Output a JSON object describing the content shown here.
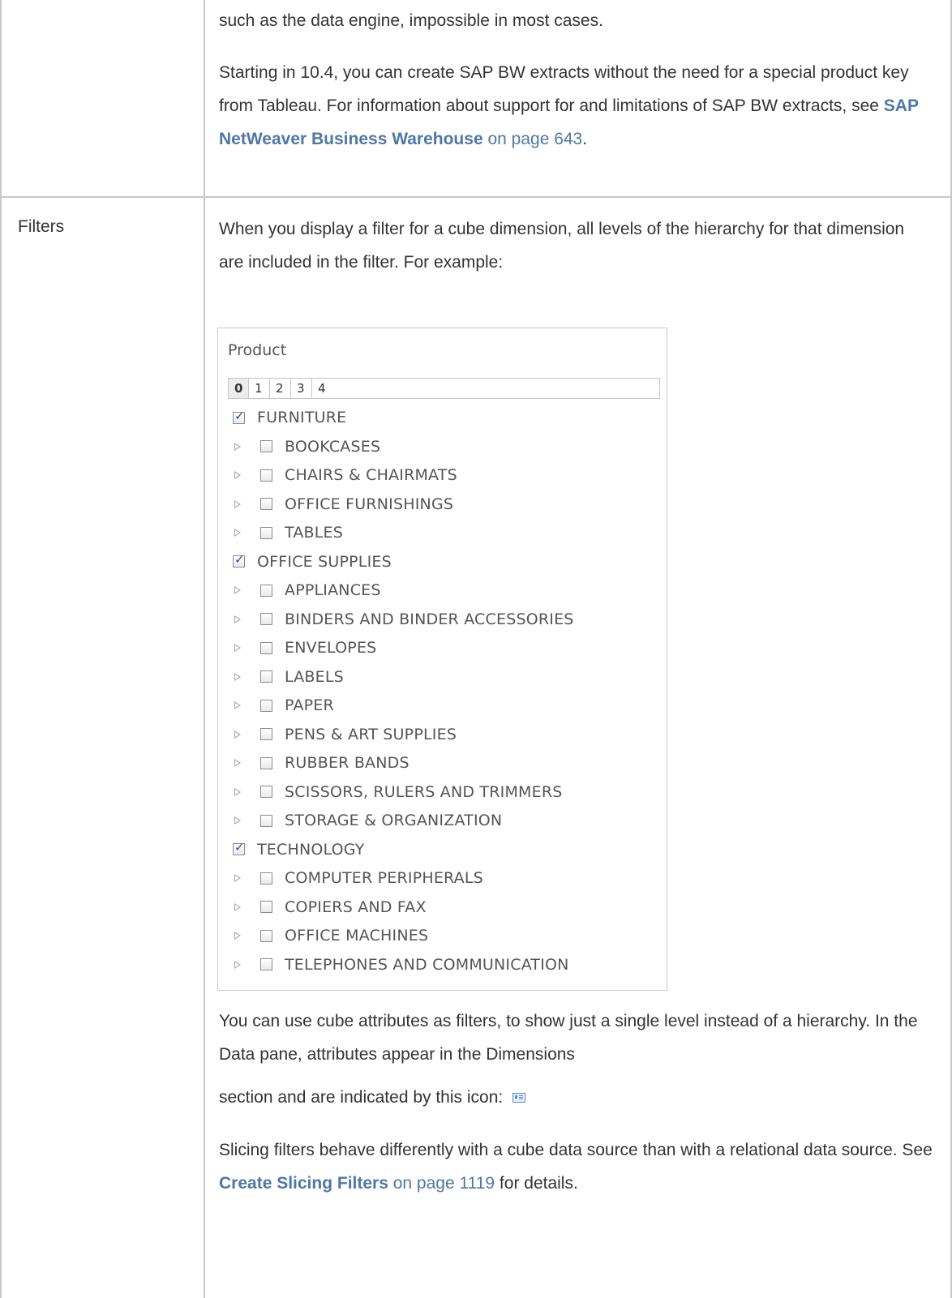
{
  "row1": {
    "continued_text": "such as the data engine, impossible in most cases.",
    "paragraph_start": "Starting in 10.4, you can create SAP BW extracts without the need for a special product key from Tableau. For information about support for and limitations of SAP BW extracts, see ",
    "link_bold": "SAP NetWeaver Business Warehouse",
    "link_page": " on page 643",
    "paragraph_end": "."
  },
  "row2": {
    "label": "Filters",
    "intro": "When you display a filter for a cube dimension, all levels of the hierarchy for that dimension are included in the filter. For example:",
    "attributes_text_1": "You can use cube attributes as filters, to show just a single level instead of a hierarchy. In the Data pane, attributes appear in the Dimensions",
    "attributes_text_2": "section and are indicated by this icon:",
    "attribute_icon": "attribute-icon",
    "slicing_start": "Slicing filters behave differently with a cube data source than with a relational data source. See ",
    "slicing_link_bold": "Create Slicing Filters",
    "slicing_link_page": " on page 1119",
    "slicing_end": " for details."
  },
  "filter_widget": {
    "title": "Product",
    "levels": [
      "0",
      "1",
      "2",
      "3",
      "4"
    ],
    "selected_level": "0",
    "items": [
      {
        "label": "FURNITURE",
        "level": 0,
        "checked": true
      },
      {
        "label": "BOOKCASES",
        "level": 1,
        "checked": false
      },
      {
        "label": "CHAIRS & CHAIRMATS",
        "level": 1,
        "checked": false
      },
      {
        "label": "OFFICE FURNISHINGS",
        "level": 1,
        "checked": false
      },
      {
        "label": "TABLES",
        "level": 1,
        "checked": false
      },
      {
        "label": "OFFICE SUPPLIES",
        "level": 0,
        "checked": true
      },
      {
        "label": "APPLIANCES",
        "level": 1,
        "checked": false
      },
      {
        "label": "BINDERS AND BINDER ACCESSORIES",
        "level": 1,
        "checked": false
      },
      {
        "label": "ENVELOPES",
        "level": 1,
        "checked": false
      },
      {
        "label": "LABELS",
        "level": 1,
        "checked": false
      },
      {
        "label": "PAPER",
        "level": 1,
        "checked": false
      },
      {
        "label": "PENS & ART SUPPLIES",
        "level": 1,
        "checked": false
      },
      {
        "label": "RUBBER BANDS",
        "level": 1,
        "checked": false
      },
      {
        "label": "SCISSORS, RULERS AND TRIMMERS",
        "level": 1,
        "checked": false
      },
      {
        "label": "STORAGE & ORGANIZATION",
        "level": 1,
        "checked": false
      },
      {
        "label": "TECHNOLOGY",
        "level": 0,
        "checked": true
      },
      {
        "label": "COMPUTER PERIPHERALS",
        "level": 1,
        "checked": false
      },
      {
        "label": "COPIERS AND FAX",
        "level": 1,
        "checked": false
      },
      {
        "label": "OFFICE MACHINES",
        "level": 1,
        "checked": false
      },
      {
        "label": "TELEPHONES AND COMMUNICATION",
        "level": 1,
        "checked": false
      }
    ]
  },
  "colors": {
    "link": "#4f77a6",
    "border": "#c8c8c8",
    "check": "#2a4f8c"
  }
}
